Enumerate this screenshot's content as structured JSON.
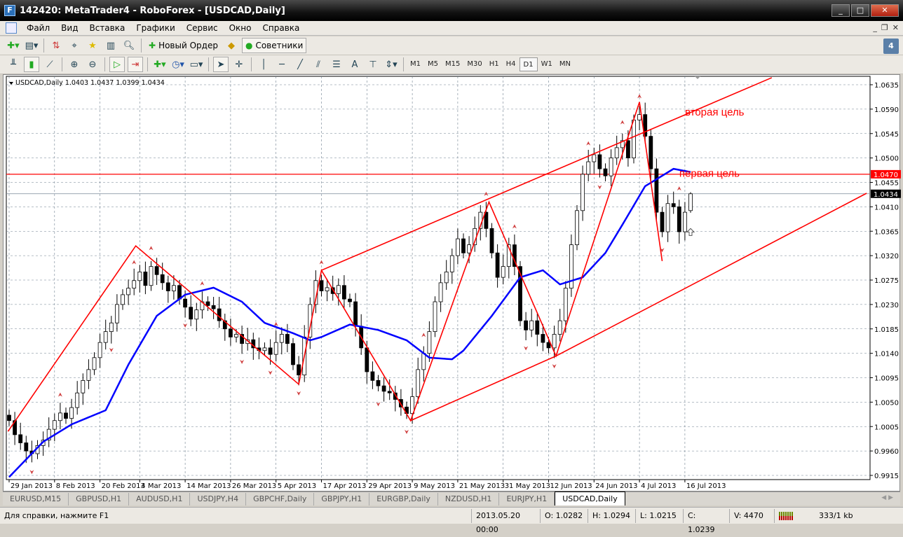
{
  "window": {
    "title": "142420: MetaTrader4 - RoboForex - [USDCAD,Daily]",
    "controls": [
      "_",
      "□",
      "✕"
    ]
  },
  "menu": [
    "Файл",
    "Вид",
    "Вставка",
    "Графики",
    "Сервис",
    "Окно",
    "Справка"
  ],
  "toolbar": {
    "new_order": "Новый Ордер",
    "experts": "Советники",
    "timeframes": [
      "M1",
      "M5",
      "M15",
      "M30",
      "H1",
      "H4",
      "D1",
      "W1",
      "MN"
    ],
    "active_timeframe": "D1",
    "text_tool": "A"
  },
  "chart": {
    "info": "USDCAD,Daily  1.0403 1.0437 1.0399 1.0434",
    "colors": {
      "bull": "#ffffff",
      "bear": "#000000",
      "ma": "#0000ff",
      "lines": "#ff0000",
      "grid": "#708090"
    },
    "price_ticks": [
      "1.0635",
      "1.0590",
      "1.0545",
      "1.0500",
      "1.0455",
      "1.0410",
      "1.0365",
      "1.0320",
      "1.0275",
      "1.0230",
      "1.0185",
      "1.0140",
      "1.0095",
      "1.0050",
      "1.0005",
      "0.9960",
      "0.9915"
    ],
    "date_ticks": [
      {
        "label": "29 Jan 2013",
        "bar": 0
      },
      {
        "label": "8 Feb 2013",
        "bar": 8
      },
      {
        "label": "20 Feb 2013",
        "bar": 16
      },
      {
        "label": "4 Mar 2013",
        "bar": 23
      },
      {
        "label": "14 Mar 2013",
        "bar": 31
      },
      {
        "label": "26 Mar 2013",
        "bar": 39
      },
      {
        "label": "5 Apr 2013",
        "bar": 47
      },
      {
        "label": "17 Apr 2013",
        "bar": 55
      },
      {
        "label": "29 Apr 2013",
        "bar": 63
      },
      {
        "label": "9 May 2013",
        "bar": 71
      },
      {
        "label": "21 May 2013",
        "bar": 79
      },
      {
        "label": "31 May 2013",
        "bar": 87
      },
      {
        "label": "12 Jun 2013",
        "bar": 95
      },
      {
        "label": "24 Jun 2013",
        "bar": 103
      },
      {
        "label": "4 Jul 2013",
        "bar": 111
      },
      {
        "label": "16 Jul 2013",
        "bar": 119
      }
    ],
    "hline": {
      "price": 1.047,
      "label": "1.0470"
    },
    "current_price": {
      "price": 1.0434,
      "label": "1.0434"
    },
    "annotations": [
      {
        "text": "вторая цель",
        "bar": 120,
        "price": 1.0585
      },
      {
        "text": "первая цель",
        "bar": 119,
        "price": 1.0472
      }
    ]
  },
  "chart_data": {
    "type": "candlestick",
    "symbol": "USDCAD",
    "timeframe": "Daily",
    "ylim": [
      0.9915,
      1.0635
    ],
    "close": [
      1.0016,
      0.999,
      0.9975,
      0.996,
      0.9955,
      0.997,
      0.998,
      1.0,
      1.0016,
      1.003,
      1.002,
      1.004,
      1.0067,
      1.009,
      1.011,
      1.0132,
      1.016,
      1.018,
      1.0196,
      1.023,
      1.0248,
      1.026,
      1.0274,
      1.029,
      1.0265,
      1.03,
      1.0285,
      1.027,
      1.0255,
      1.0265,
      1.024,
      1.0225,
      1.0203,
      1.022,
      1.0235,
      1.0228,
      1.0222,
      1.02,
      1.0185,
      1.017,
      1.0175,
      1.0158,
      1.0165,
      1.015,
      1.0145,
      1.015,
      1.0138,
      1.016,
      1.0175,
      1.0158,
      1.0119,
      1.01,
      1.017,
      1.023,
      1.0274,
      1.0255,
      1.0261,
      1.025,
      1.0265,
      1.024,
      1.0235,
      1.019,
      1.015,
      1.0106,
      1.009,
      1.008,
      1.007,
      1.0067,
      1.0055,
      1.0041,
      1.0029,
      1.006,
      1.011,
      1.014,
      1.018,
      1.0235,
      1.027,
      1.029,
      1.032,
      1.0351,
      1.0325,
      1.034,
      1.037,
      1.04,
      1.037,
      1.0325,
      1.028,
      1.03,
      1.034,
      1.03,
      1.02,
      1.0183,
      1.02,
      1.0175,
      1.016,
      1.015,
      1.0175,
      1.02,
      1.026,
      1.034,
      1.0403,
      1.047,
      1.0493,
      1.0506,
      1.048,
      1.0467,
      1.05,
      1.0519,
      1.0532,
      1.05,
      1.057,
      1.058,
      1.054,
      1.048,
      1.04,
      1.0364,
      1.0416,
      1.041,
      1.0364,
      1.04,
      1.0434
    ],
    "last_bar": {
      "open": 1.0403,
      "high": 1.0437,
      "low": 1.0399,
      "close": 1.0434
    },
    "moving_average": [
      [
        0,
        0.9912
      ],
      [
        6,
        0.9977
      ],
      [
        11,
        1.0009
      ],
      [
        17,
        1.0035
      ],
      [
        21,
        1.0119
      ],
      [
        26,
        1.0209
      ],
      [
        31,
        1.0248
      ],
      [
        36,
        1.0261
      ],
      [
        41,
        1.0235
      ],
      [
        45,
        1.0196
      ],
      [
        50,
        1.0177
      ],
      [
        53,
        1.0164
      ],
      [
        55,
        1.017
      ],
      [
        60,
        1.0193
      ],
      [
        65,
        1.0183
      ],
      [
        70,
        1.0164
      ],
      [
        74,
        1.0132
      ],
      [
        78,
        1.0129
      ],
      [
        80,
        1.0145
      ],
      [
        85,
        1.0209
      ],
      [
        90,
        1.028
      ],
      [
        94,
        1.0293
      ],
      [
        97,
        1.0267
      ],
      [
        101,
        1.028
      ],
      [
        105,
        1.0325
      ],
      [
        108,
        1.0377
      ],
      [
        112,
        1.0448
      ],
      [
        117,
        1.048
      ],
      [
        120,
        1.0474
      ]
    ],
    "zigzag": [
      [
        -0.2,
        0.9996
      ],
      [
        22.3,
        1.0338
      ],
      [
        51,
        1.0083
      ],
      [
        55,
        1.0293
      ],
      [
        70.7,
        1.0016
      ],
      [
        84.5,
        1.0419
      ],
      [
        96.3,
        1.0135
      ],
      [
        111,
        1.0603
      ],
      [
        115,
        1.031
      ]
    ],
    "channel_upper": [
      [
        55,
        1.0293
      ],
      [
        134.3,
        1.0648
      ]
    ],
    "channel_lower": [
      [
        70.7,
        1.0016
      ],
      [
        96.3,
        1.0135
      ],
      [
        151,
        1.0435
      ]
    ],
    "fractals_up": [
      9,
      22,
      25,
      34,
      47,
      55,
      73,
      84,
      89,
      102,
      108,
      111,
      118
    ],
    "fractals_down": [
      4,
      18,
      31,
      41,
      46,
      51,
      65,
      70,
      91,
      96,
      104,
      115
    ]
  },
  "tabs": [
    {
      "label": "EURUSD,M15"
    },
    {
      "label": "GBPUSD,H1"
    },
    {
      "label": "AUDUSD,H1"
    },
    {
      "label": "USDJPY,H4"
    },
    {
      "label": "GBPCHF,Daily"
    },
    {
      "label": "GBPJPY,H1"
    },
    {
      "label": "EURGBP,Daily"
    },
    {
      "label": "NZDUSD,H1"
    },
    {
      "label": "EURJPY,H1"
    },
    {
      "label": "USDCAD,Daily",
      "active": true
    }
  ],
  "status": {
    "help": "Для справки, нажмите F1",
    "time": "2013.05.20 00:00",
    "open": "O: 1.0282",
    "high": "H: 1.0294",
    "low": "L: 1.0215",
    "close": "C: 1.0239",
    "volume": "V: 4470",
    "traffic": "333/1 kb"
  }
}
